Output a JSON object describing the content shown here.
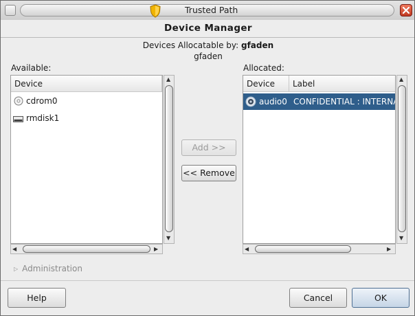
{
  "window": {
    "title": "Trusted Path"
  },
  "dialog": {
    "title": "Device Manager",
    "allocatable_prefix": "Devices Allocatable by:",
    "allocatable_user": "gfaden",
    "current_user": "gfaden"
  },
  "available": {
    "label": "Available:",
    "column": "Device",
    "items": [
      {
        "name": "cdrom0",
        "icon": "cd-disc-icon"
      },
      {
        "name": "rmdisk1",
        "icon": "removable-disk-icon"
      }
    ]
  },
  "allocated": {
    "label": "Allocated:",
    "columns": [
      "Device",
      "Label"
    ],
    "rows": [
      {
        "device": "audio0",
        "label": "CONFIDENTIAL : INTERNA",
        "icon": "audio-device-icon",
        "selected": true
      }
    ]
  },
  "actions": {
    "add": "Add >>",
    "remove": "<< Remove"
  },
  "administration": {
    "label": "Administration",
    "expanded": false
  },
  "footer": {
    "help": "Help",
    "cancel": "Cancel",
    "ok": "OK"
  },
  "colors": {
    "selection": "#2f5e8b",
    "close_button": "#d9553a",
    "shield": "#f0b400"
  }
}
